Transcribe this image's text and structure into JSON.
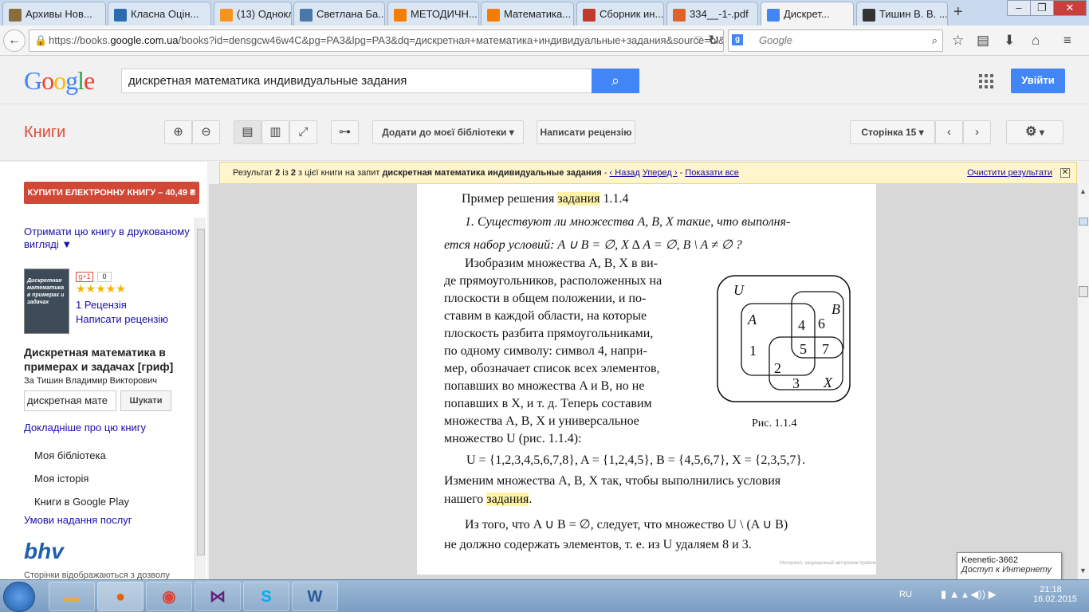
{
  "browser": {
    "tabs": [
      {
        "title": "Архивы Нов...",
        "icon_color": "#8a6d3b"
      },
      {
        "title": "Класна Оцін...",
        "icon_color": "#2b6cb0"
      },
      {
        "title": "(13) Однокл...",
        "icon_color": "#f7931e"
      },
      {
        "title": "Светлана Ба...",
        "icon_color": "#4a76a8"
      },
      {
        "title": "МЕТОДИЧН...",
        "icon_color": "#f57d00"
      },
      {
        "title": "Математика...",
        "icon_color": "#f57d00"
      },
      {
        "title": "Сборник ин...",
        "icon_color": "#c0392b"
      },
      {
        "title": "334__-1-.pdf",
        "icon_color": "#e0622a"
      },
      {
        "title": "Дискрет...",
        "icon_color": "#4285f4"
      },
      {
        "title": "Тишин В. В. ...",
        "icon_color": "#333333"
      }
    ],
    "tab_icons": [
      "archive-icon",
      "school-icon",
      "ok-icon",
      "vk-icon",
      "blogger-icon",
      "blogger-icon",
      "ab-icon",
      "pdf-icon",
      "google-icon",
      "site-icon"
    ],
    "url_prefix": "https://books.",
    "url_host": "google.com.ua",
    "url_rest": "/books?id=densgcw46w4C&pg=PA3&lpg=PA3&dq=дискретная+математика+индивидуальные+задания&source=bl&ots",
    "search_placeholder": "Google"
  },
  "google": {
    "query": "дискретная математика индивидуальные задания",
    "signin_label": "Увійти"
  },
  "toolbar": {
    "section_title": "Книги",
    "add_library": "Додати до моєї бібліотеки",
    "write_review": "Написати рецензію",
    "page_label": "Сторінка 15"
  },
  "resultbar": {
    "prefix": "Результат ",
    "num": "2",
    "mid": " із ",
    "total": "2",
    "text1": " з цієї книги на запит ",
    "query": "дискретная математика индивидуальные задания",
    "prev": "‹ Назад",
    "next": "Уперед ›",
    "show_all": "Показати все",
    "clear": "Очистити результати"
  },
  "sidebar": {
    "buy": "КУПИТИ ЕЛЕКТРОННУ КНИГУ – 40,49 ₴",
    "print_link": "Отримати цю книгу в друкованому вигляді ▼",
    "plus_count": "0",
    "review_count": "1 Рецензія",
    "write_review": "Написати рецензію",
    "book_title": "Дискретная математика в примерах и задачах [гриф]",
    "author": "За Тишин Владимир Викторович",
    "search_value": "дискретная мате",
    "search_btn": "Шукати",
    "more_about": "Докладніше про цю книгу",
    "my_library": "Моя бібліотека",
    "my_history": "Моя історія",
    "play_books": "Книги в Google Play",
    "terms": "Умови надання послуг",
    "publisher": "bhv",
    "pages_note": "Сторінки відображаються з дозволу",
    "cover_title": "Дискретная математика в примерах и задачах"
  },
  "page": {
    "heading_pre": "Пример решения ",
    "heading_hl": "задания",
    "heading_post": " 1.1.4",
    "task1": "1. Существуют ли множества  A, B, X такие, что выполня-",
    "task2": "ется набор условий:  A ∪ B = ∅,  X ∆ A = ∅,  B \\ A ≠ ∅ ?",
    "para": [
      "Изобразим множества  A, B, X в ви-",
      "де прямоугольников, расположенных на",
      "плоскости  в  общем  положении,  и  по-",
      "ставим  в  каждой  области,  на  которые",
      "плоскость  разбита  прямоугольниками,",
      "по  одному  символу:  символ  4,  напри-",
      "мер, обозначает список всех элементов,",
      "попавших во множества  A  и  B,  но не",
      "попавших в  X,  и т. д. Теперь составим",
      "множества   A,   B,   X   и универсальное",
      "множество  U  (рис. 1.1.4):"
    ],
    "sets": "U = {1,2,3,4,5,6,7,8},     A = {1,2,4,5},     B = {4,5,6,7},     X = {2,3,5,7}.",
    "change1": "Изменим  множества  A,  B,  X  так, чтобы выполнились условия",
    "change2_pre": "нашего ",
    "change2_hl": "задания",
    "change2_post": ".",
    "last1": "Из того, что  A ∪ B = ∅, следует, что множество  U \\ (A ∪ B)",
    "last2": "не  должно  содержать  элементов,  т.  е.  из  U   удаляем  8  и  3.",
    "figure_caption": "Рис. 1.1.4",
    "copyright": "Материал, защищенный авторским правом",
    "venn": {
      "U": "U",
      "A": "A",
      "B": "B",
      "X": "X",
      "n1": "1",
      "n2": "2",
      "n3": "3",
      "n4": "4",
      "n5": "5",
      "n6": "6",
      "n7": "7"
    }
  },
  "tooltip": {
    "line1": "Keenetic-3662",
    "line2": "Доступ к Интернету"
  },
  "taskbar": {
    "lang": "RU",
    "time": "21:18",
    "date": "16.02.2015"
  }
}
